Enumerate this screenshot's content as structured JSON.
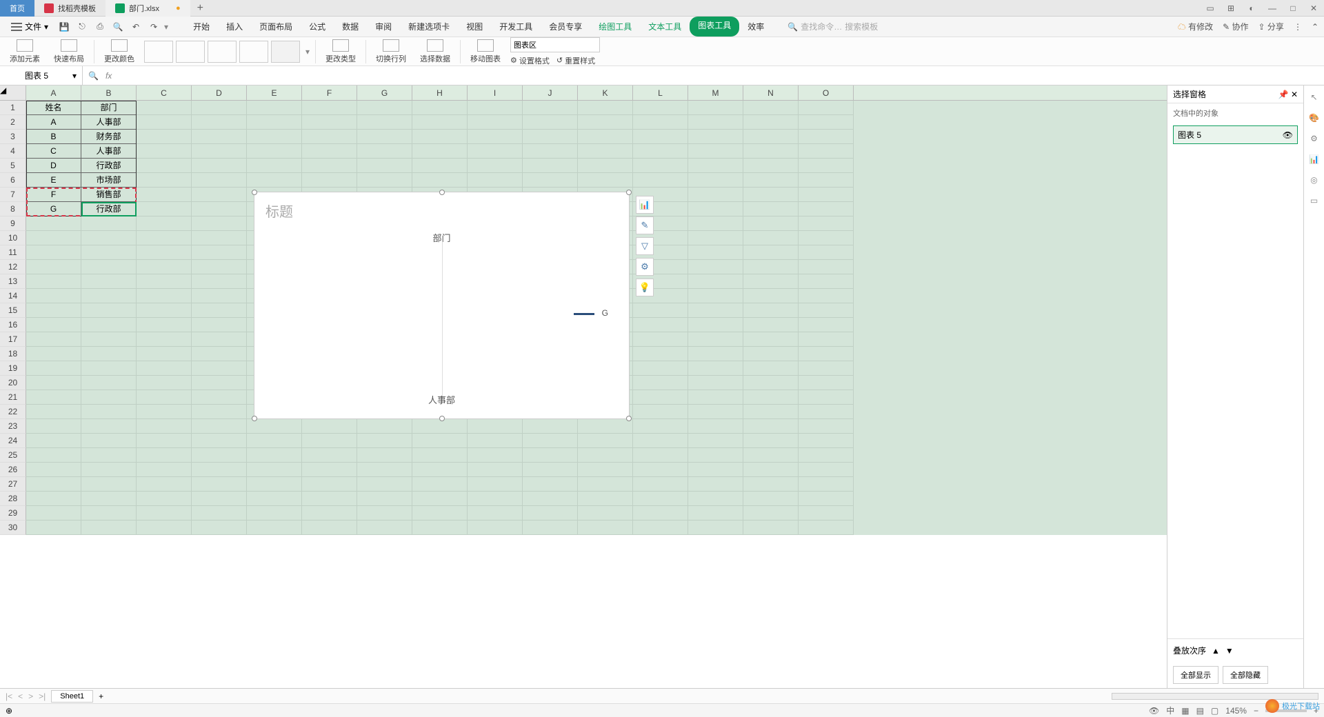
{
  "titlebar": {
    "home_tab": "首页",
    "template_tab": "找稻壳模板",
    "file_tab": "部门.xlsx",
    "add": "+"
  },
  "menubar": {
    "file_btn": "文件",
    "tabs": [
      "开始",
      "插入",
      "页面布局",
      "公式",
      "数据",
      "审阅",
      "新建选项卡",
      "视图",
      "开发工具",
      "会员专享"
    ],
    "green_tabs": [
      "绘图工具",
      "文本工具"
    ],
    "pill_tab": "图表工具",
    "extra_tab": "效率",
    "search_cmd": "查找命令…",
    "search_tpl": "搜索模板",
    "has_changes": "有修改",
    "coop": "协作",
    "share": "分享"
  },
  "ribbon": {
    "add_element": "添加元素",
    "quick_layout": "快速布局",
    "change_color": "更改颜色",
    "change_type": "更改类型",
    "switch_rowcol": "切换行列",
    "select_data": "选择数据",
    "move_chart": "移动图表",
    "set_format": "设置格式",
    "reset_style": "重置样式",
    "chart_area": "图表区"
  },
  "namebox": {
    "value": "图表 5"
  },
  "columns": [
    "A",
    "B",
    "C",
    "D",
    "E",
    "F",
    "G",
    "H",
    "I",
    "J",
    "K",
    "L",
    "M",
    "N",
    "O"
  ],
  "rows": 30,
  "table": {
    "h1": "姓名",
    "h2": "部门",
    "r1a": "A",
    "r1b": "人事部",
    "r2a": "B",
    "r2b": "财务部",
    "r3a": "C",
    "r3b": "人事部",
    "r4a": "D",
    "r4b": "行政部",
    "r5a": "E",
    "r5b": "市场部",
    "r6a": "F",
    "r6b": "销售部",
    "r7a": "G",
    "r7b": "行政部"
  },
  "chart_data": {
    "type": "line",
    "title": "标题",
    "subtitle": "部门",
    "categories": [
      "人事部"
    ],
    "series": [
      {
        "name": "G",
        "values": [
          null
        ]
      }
    ],
    "xlabel": "人事部",
    "legend_position": "right"
  },
  "right_panel": {
    "title": "选择窗格",
    "subtitle": "文档中的对象",
    "item": "图表 5",
    "stack_order": "叠放次序",
    "show_all": "全部显示",
    "hide_all": "全部隐藏"
  },
  "sheet": {
    "name": "Sheet1",
    "add": "+"
  },
  "statusbar": {
    "zoom": "145%"
  },
  "watermark": "极光下载站"
}
